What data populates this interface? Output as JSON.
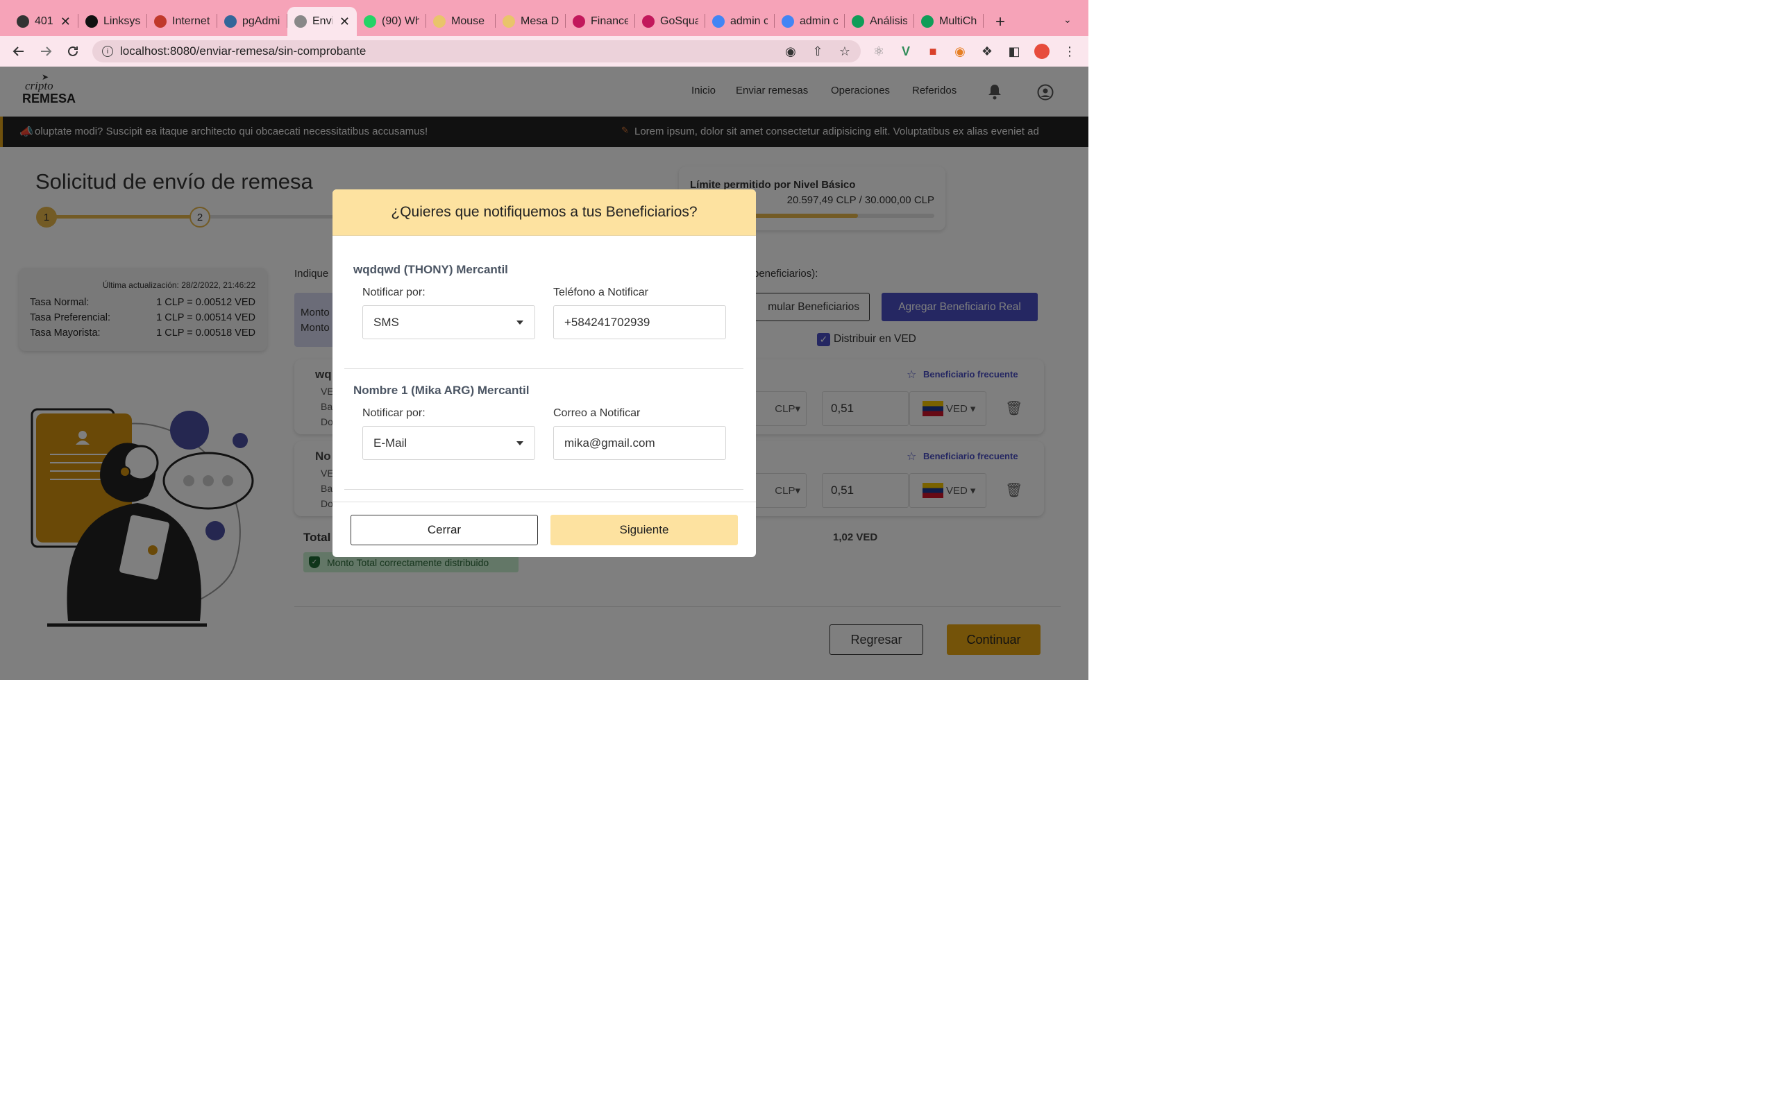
{
  "browser": {
    "tabs": [
      {
        "title": "401",
        "fav_color": "#333",
        "closable": true
      },
      {
        "title": "Linksys",
        "fav_color": "#111"
      },
      {
        "title": "Internet",
        "fav_color": "#c0392b"
      },
      {
        "title": "pgAdmin",
        "fav_color": "#336699"
      },
      {
        "title": "Envi",
        "fav_color": "#888",
        "active": true,
        "closable": true
      },
      {
        "title": "(90) Wh",
        "fav_color": "#25d366"
      },
      {
        "title": "Mouse",
        "fav_color": "#e9c46a"
      },
      {
        "title": "Mesa D",
        "fav_color": "#e9c46a"
      },
      {
        "title": "Finance",
        "fav_color": "#c2185b"
      },
      {
        "title": "GoSqua",
        "fav_color": "#c2185b"
      },
      {
        "title": "admin c",
        "fav_color": "#4285f4"
      },
      {
        "title": "admin c",
        "fav_color": "#4285f4"
      },
      {
        "title": "Análisis",
        "fav_color": "#0f9d58"
      },
      {
        "title": "MultiCh",
        "fav_color": "#0f9d58"
      }
    ],
    "url": "localhost:8080/enviar-remesa/sin-comprobante"
  },
  "nav": {
    "logo_top": "cripto",
    "logo_bottom": "REMESA",
    "links": [
      "Inicio",
      "Enviar remesas",
      "Operaciones",
      "Referidos"
    ]
  },
  "marquee": {
    "text1": "oluptate modi? Suscipit ea itaque architecto qui obcaecati necessitatibus accusamus!",
    "text2": "Lorem ipsum, dolor sit amet consectetur adipisicing elit. Voluptatibus ex alias eveniet ad"
  },
  "main": {
    "title": "Solicitud de envío de remesa",
    "step1": "1",
    "step2": "2",
    "limit_title": "Límite permitido por Nivel Básico",
    "limit_value": "20.597,49 CLP / 30.000,00 CLP",
    "limit_fraction": 0.6866,
    "rates": {
      "updated": "Última actualización: 28/2/2022, 21:46:22",
      "rows": [
        {
          "label": "Tasa Normal:",
          "value": "1 CLP = 0.00512 VED"
        },
        {
          "label": "Tasa Preferencial:",
          "value": "1 CLP = 0.00514 VED"
        },
        {
          "label": "Tasa Mayorista:",
          "value": "1 CLP = 0.00518 VED"
        }
      ]
    },
    "indique": "Indique",
    "beneficiarios_hint": "beneficiarios):",
    "monto1": "Monto",
    "monto2": "Monto",
    "simular": "mular Beneficiarios",
    "agregar": "Agregar Beneficiario Real",
    "distribuir": "Distribuir en VED",
    "frecuente": "Beneficiario frecuente",
    "ben1_initial": "wq",
    "ben2_initial": "No",
    "row_labels": [
      "VE",
      "Ba",
      "Do"
    ],
    "clp": "CLP",
    "ved": "VED",
    "amount": "0,51",
    "total_label": "Total",
    "total_value": "1,02 VED",
    "success": "Monto Total correctamente distribuido",
    "regresar": "Regresar",
    "continuar": "Continuar"
  },
  "modal": {
    "title": "¿Quieres que notifiquemos a tus Beneficiarios?",
    "beneficiaries": [
      {
        "name": "wqdqwd (THONY) Mercantil",
        "notify_label": "Notificar por:",
        "notify_value": "SMS",
        "target_label": "Teléfono a Notificar",
        "target_value": "+584241702939"
      },
      {
        "name": "Nombre 1 (Mika ARG) Mercantil",
        "notify_label": "Notificar por:",
        "notify_value": "E-Mail",
        "target_label": "Correo a Notificar",
        "target_value": "mika@gmail.com"
      }
    ],
    "close": "Cerrar",
    "next": "Siguiente"
  }
}
